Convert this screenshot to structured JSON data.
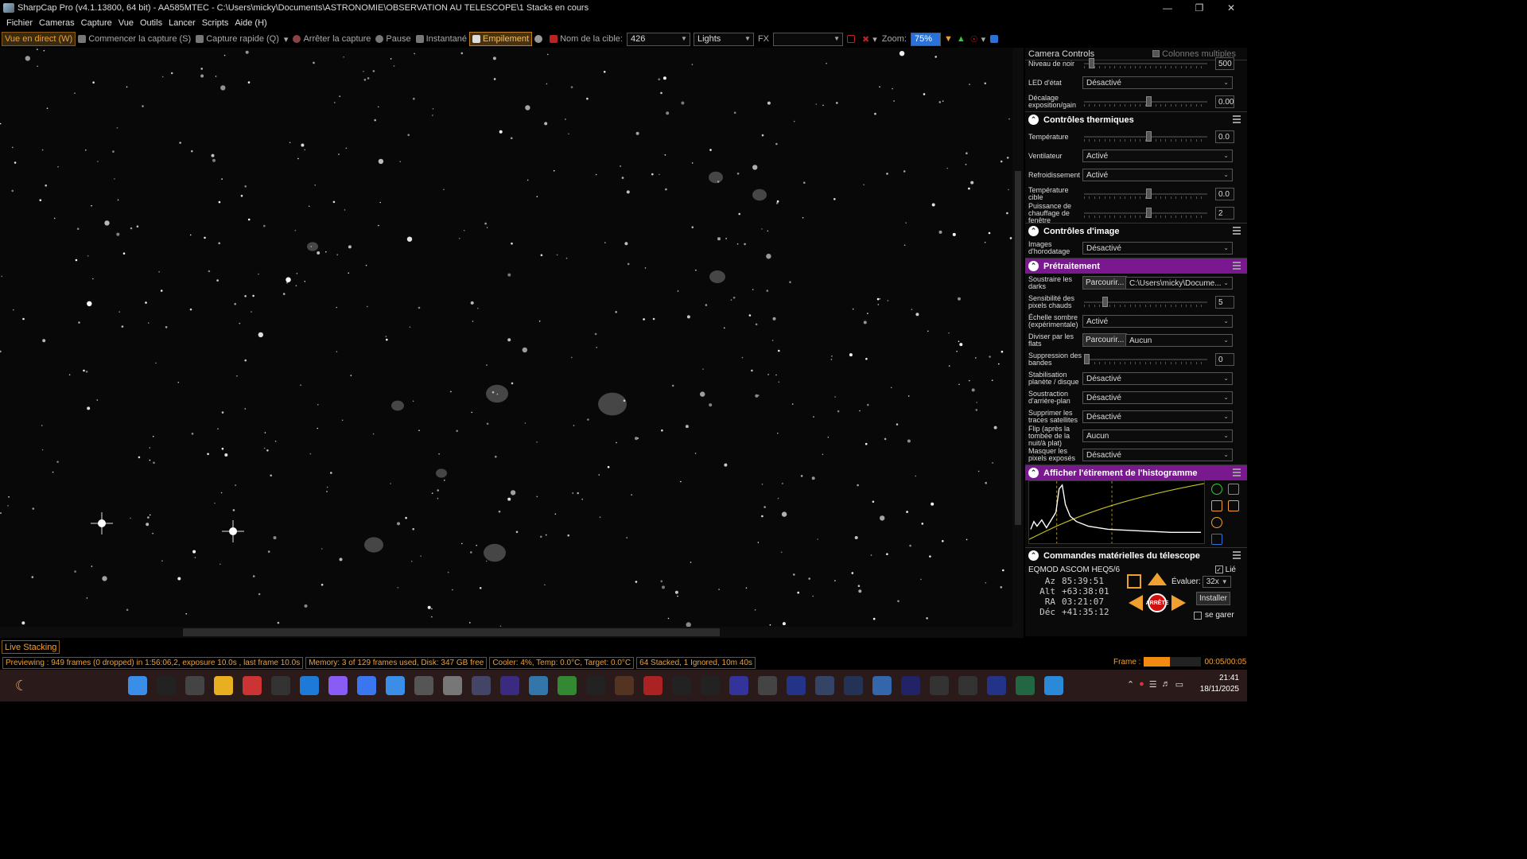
{
  "window": {
    "title": "SharpCap Pro (v4.1.13800, 64 bit) - AA585MTEC - C:\\Users\\micky\\Documents\\ASTRONOMIE\\OBSERVATION AU TELESCOPE\\1 Stacks en cours"
  },
  "menu": [
    "Fichier",
    "Cameras",
    "Capture",
    "Vue",
    "Outils",
    "Lancer",
    "Scripts",
    "Aide (H)"
  ],
  "toolbar": {
    "live_view": "Vue en direct (W)",
    "start_capture": "Commencer la capture (S)",
    "quick_capture": "Capture rapide (Q)",
    "stop_capture": "Arrêter la capture",
    "pause": "Pause",
    "snapshot": "Instantané",
    "stacking": "Empilement",
    "target_label": "Nom de la cible:",
    "target_value": "426",
    "frame_type": "Lights",
    "fx_label": "FX",
    "zoom_label": "Zoom:",
    "zoom_value": "75%"
  },
  "panel": {
    "header": "Camera Controls",
    "multi_columns": "Colonnes multiples",
    "top_rows": [
      {
        "label": "Niveau de noir",
        "type": "slider",
        "value": "500"
      },
      {
        "label": "LED d'état",
        "type": "dropdown",
        "value": "Désactivé"
      },
      {
        "label": "Décalage exposition/gain",
        "type": "slider",
        "value": "0.00"
      }
    ],
    "thermal": {
      "title": "Contrôles thermiques",
      "rows": [
        {
          "label": "Température",
          "type": "slider",
          "value": "0.0"
        },
        {
          "label": "Ventilateur",
          "type": "dropdown",
          "value": "Activé"
        },
        {
          "label": "Refroidissement",
          "type": "dropdown",
          "value": "Activé"
        },
        {
          "label": "Température cible",
          "type": "slider",
          "value": "0.0"
        },
        {
          "label": "Puissance de chauffage de fenêtre",
          "type": "slider",
          "value": "2"
        }
      ]
    },
    "image": {
      "title": "Contrôles d'image",
      "rows": [
        {
          "label": "Images d'horodatage",
          "type": "dropdown",
          "value": "Désactivé"
        }
      ]
    },
    "preprocess": {
      "title": "Prétraitement",
      "browse": "Parcourir...",
      "dark_path": "C:\\Users\\micky\\Docume...",
      "flat_value": "Aucun",
      "rows": [
        {
          "label": "Soustraire les darks",
          "type": "browse"
        },
        {
          "label": "Sensibilité des pixels chauds",
          "type": "slider",
          "value": "5"
        },
        {
          "label": "Échelle sombre (expérimentale)",
          "type": "dropdown",
          "value": "Activé"
        },
        {
          "label": "Diviser par les flats",
          "type": "browse2"
        },
        {
          "label": "Suppression des bandes",
          "type": "slider",
          "value": "0"
        },
        {
          "label": "Stabilisation planète / disque",
          "type": "dropdown",
          "value": "Désactivé"
        },
        {
          "label": "Soustraction d'arrière-plan",
          "type": "dropdown",
          "value": "Désactivé"
        },
        {
          "label": "Supprimer les traces satellites",
          "type": "dropdown",
          "value": "Désactivé"
        },
        {
          "label": "Flip (après la tombée de la nuit/à plat)",
          "type": "dropdown",
          "value": "Aucun"
        },
        {
          "label": "Masquer les pixels exposés",
          "type": "dropdown",
          "value": "Désactivé"
        }
      ]
    },
    "histogram": {
      "title": "Afficher l'étirement de l'histogramme"
    },
    "telescope": {
      "title": "Commandes matérielles du télescope",
      "mount": "EQMOD ASCOM HEQ5/6",
      "linked": "Lié",
      "az_label": "Az",
      "az": "85:39:51",
      "alt_label": "Alt",
      "alt": "+63:38:01",
      "ra_label": "RA",
      "ra": "03:21:07",
      "dec_label": "Déc",
      "dec": "+41:35:12",
      "rate_label": "Évaluer:",
      "rate": "32x",
      "install": "Installer",
      "park": "se garer",
      "stop": "ARRÊTE"
    }
  },
  "live_stacking_tab": "Live Stacking",
  "status": {
    "preview": "Previewing : 949 frames (0 dropped) in 1:56:06,2, exposure 10.0s , last frame 10.0s",
    "memory": "Memory: 3 of 129 frames used, Disk: 347 GB free",
    "cooler": "Cooler: 4%, Temp: 0.0°C, Target: 0.0°C",
    "stacked": "64 Stacked, 1 Ignored, 10m 40s",
    "frame_label": "Frame :",
    "frame_time": "00:05/00:05",
    "frame_progress": 0.45
  },
  "taskbar": {
    "time": "21:41",
    "date": "18/11/2025"
  },
  "colors": {
    "accent": "#f0a030",
    "purple": "#7a1890",
    "zoom": "#2a72d8"
  }
}
